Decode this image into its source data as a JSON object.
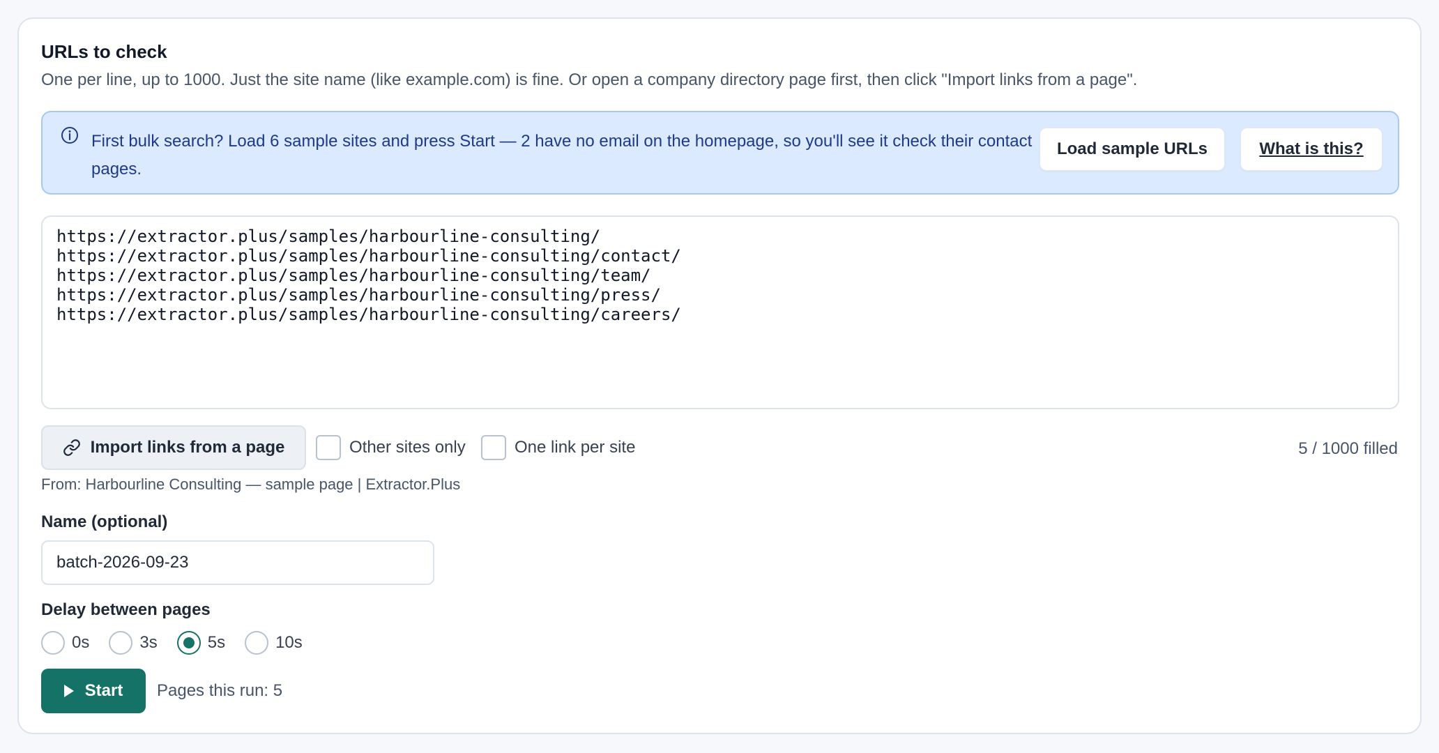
{
  "section": {
    "title": "URLs to check",
    "subtitle": "One per line, up to 1000. Just the site name (like example.com) is fine. Or open a company directory page first, then click \"Import links from a page\"."
  },
  "info": {
    "icon": "info-icon",
    "text": "First bulk search? Load 6 sample sites and press Start — 2 have no email on the homepage, so you'll see it check their contact pages.",
    "load_label": "Load sample URLs",
    "what_label": "What is this?"
  },
  "urls": {
    "value": "https://extractor.plus/samples/harbourline-consulting/\nhttps://extractor.plus/samples/harbourline-consulting/contact/\nhttps://extractor.plus/samples/harbourline-consulting/team/\nhttps://extractor.plus/samples/harbourline-consulting/press/\nhttps://extractor.plus/samples/harbourline-consulting/careers/"
  },
  "import": {
    "icon": "link-icon",
    "label": "Import links from a page",
    "other_sites_label": "Other sites only",
    "one_per_site_label": "One link per site",
    "filled": "5 / 1000 filled",
    "from": "From: Harbourline Consulting — sample page | Extractor.Plus"
  },
  "name": {
    "label": "Name (optional)",
    "value": "batch-2026-09-23"
  },
  "delay": {
    "label": "Delay between pages",
    "options": [
      "0s",
      "3s",
      "5s",
      "10s"
    ],
    "selected": "5s"
  },
  "start": {
    "icon": "play-icon",
    "label": "Start",
    "pages_run": "Pages this run: 5"
  },
  "colors": {
    "accent": "#157266",
    "info_bg": "#dbeafe",
    "info_text": "#1e3a8a"
  }
}
